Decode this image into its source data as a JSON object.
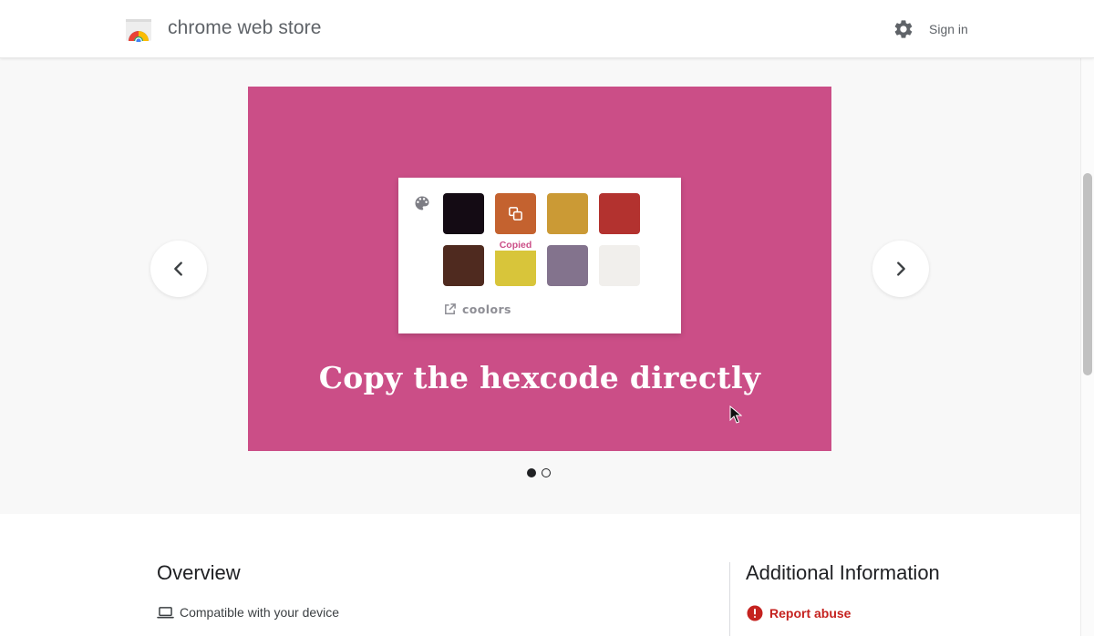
{
  "header": {
    "logo_icon": "chrome-web-store-logo",
    "title": "chrome web store",
    "settings_icon": "gear-icon",
    "sign_in_label": "Sign in"
  },
  "carousel": {
    "slide": {
      "background_color": "#cb4e87",
      "swatch_colors": [
        "#140b14",
        "#c4622f",
        "#cb9a35",
        "#b3322f",
        "#4f2a1f",
        "#d8c53a",
        "#83738d",
        "#f1efec"
      ],
      "copied_label": "Copied",
      "brand_text": "coolors",
      "caption": "Copy the hexcode directly"
    },
    "prev_icon": "chevron-left-icon",
    "next_icon": "chevron-right-icon",
    "dots": [
      {
        "active": true
      },
      {
        "active": false
      }
    ]
  },
  "overview": {
    "title": "Overview",
    "compat_icon": "laptop-icon",
    "compat_text": "Compatible with your device"
  },
  "additional_info": {
    "title": "Additional Information",
    "report_icon": "alert-circle-icon",
    "report_label": "Report abuse",
    "report_color": "#c5221f"
  }
}
